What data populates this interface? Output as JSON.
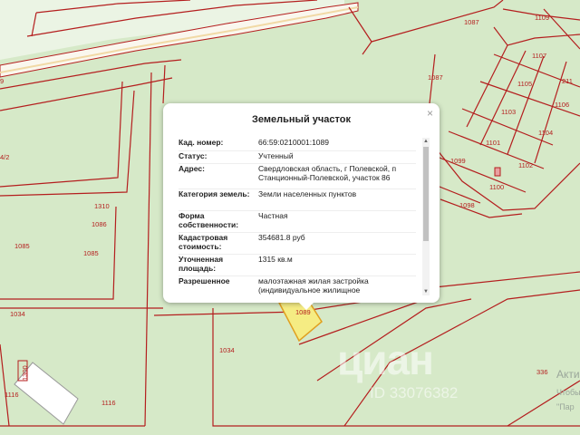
{
  "map": {
    "colors": {
      "land": "#d6e9c8",
      "boundary": "#b41e1e",
      "road": "#faf7ee",
      "selected_fill": "#f5ec83"
    },
    "plot_labels": [
      "1109",
      "1087",
      "1107",
      "1105",
      "1106",
      "211",
      "1103",
      "1104",
      "1087",
      "1101",
      "1102",
      "1099",
      "1100",
      "1098",
      "1310",
      "1086",
      "1085",
      "1085",
      "1034",
      "1034",
      "1116",
      "1116",
      "1300",
      "336",
      "1089",
      "4/2",
      "9"
    ]
  },
  "popup": {
    "title": "Земельный участок",
    "close_label": "×",
    "rows": [
      {
        "key": "Кад. номер:",
        "value": "66:59:0210001:1089"
      },
      {
        "key": "Статус:",
        "value": "Учтенный"
      },
      {
        "key": "Адрес:",
        "value": "Свердловская область, г Полевской, п Станционный-Полевской, участок 86"
      },
      {
        "key": "Категория земель:",
        "value": "Земли населенных пунктов"
      },
      {
        "key": "Форма собственности:",
        "value": "Частная"
      },
      {
        "key": "Кадастровая стоимость:",
        "value": "354681.8 руб"
      },
      {
        "key": "Уточненная площадь:",
        "value": "1315 кв.м"
      },
      {
        "key": "Разрешенное",
        "value": "малоэтажная жилая застройка (индивидуальное жилищное"
      }
    ],
    "scroll_up": "▲",
    "scroll_down": "▼"
  },
  "watermark": {
    "logo": "циан",
    "domain": "ID 33076382",
    "activate_title": "Акти",
    "activate_line1": "Чтобы",
    "activate_line2": "\"Пар"
  }
}
